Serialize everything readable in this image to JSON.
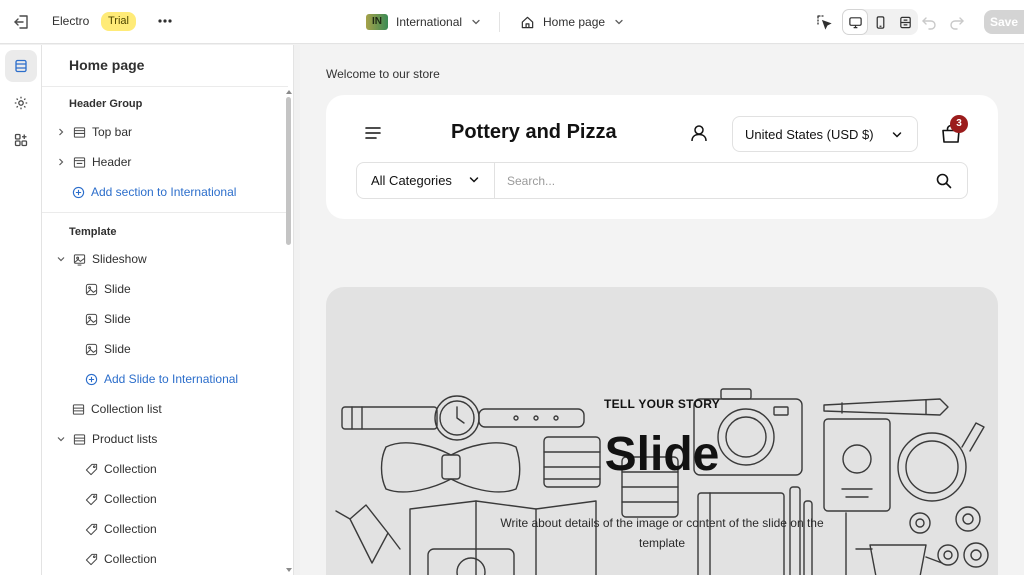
{
  "topbar": {
    "store_name": "Electro",
    "trial_badge": "Trial",
    "market_flag": "IN",
    "market_label": "International",
    "page_label": "Home page",
    "save_label": "Save"
  },
  "sidebar": {
    "title": "Home page",
    "header_group": {
      "label": "Header Group",
      "items": [
        {
          "label": "Top bar"
        },
        {
          "label": "Header"
        }
      ],
      "add_label": "Add section to International"
    },
    "template": {
      "label": "Template",
      "slideshow": {
        "label": "Slideshow",
        "slides": [
          {
            "label": "Slide"
          },
          {
            "label": "Slide"
          },
          {
            "label": "Slide"
          }
        ],
        "add_label": "Add Slide to International"
      },
      "collection_list": "Collection list",
      "product_lists": {
        "label": "Product lists",
        "items": [
          {
            "label": "Collection"
          },
          {
            "label": "Collection"
          },
          {
            "label": "Collection"
          },
          {
            "label": "Collection"
          }
        ]
      }
    }
  },
  "preview": {
    "welcome": "Welcome to our store",
    "store_name": "Pottery and Pizza",
    "currency": "United States (USD $)",
    "cart_count": "3",
    "category_select": "All Categories",
    "search_placeholder": "Search...",
    "slide": {
      "subheading": "TELL YOUR STORY",
      "heading": "Slide",
      "text": "Write about details of the image or content of the slide on the template"
    }
  },
  "colors": {
    "accent_link": "#2c6ecb",
    "trial_badge_bg": "#ffeb78",
    "cart_badge_bg": "#9b1c1c",
    "save_disabled": "#d4d4d4"
  },
  "icons": [
    "exit-icon",
    "more-icon",
    "chevron-down-icon",
    "home-icon",
    "inspector-icon",
    "desktop-icon",
    "mobile-icon",
    "fullscreen-icon",
    "undo-icon",
    "redo-icon",
    "sections-icon",
    "settings-icon",
    "apps-icon",
    "chevron-right-icon",
    "section-icon",
    "slide-icon",
    "add-circle-icon",
    "tag-icon",
    "menu-icon",
    "user-icon",
    "cart-icon",
    "search-icon"
  ]
}
